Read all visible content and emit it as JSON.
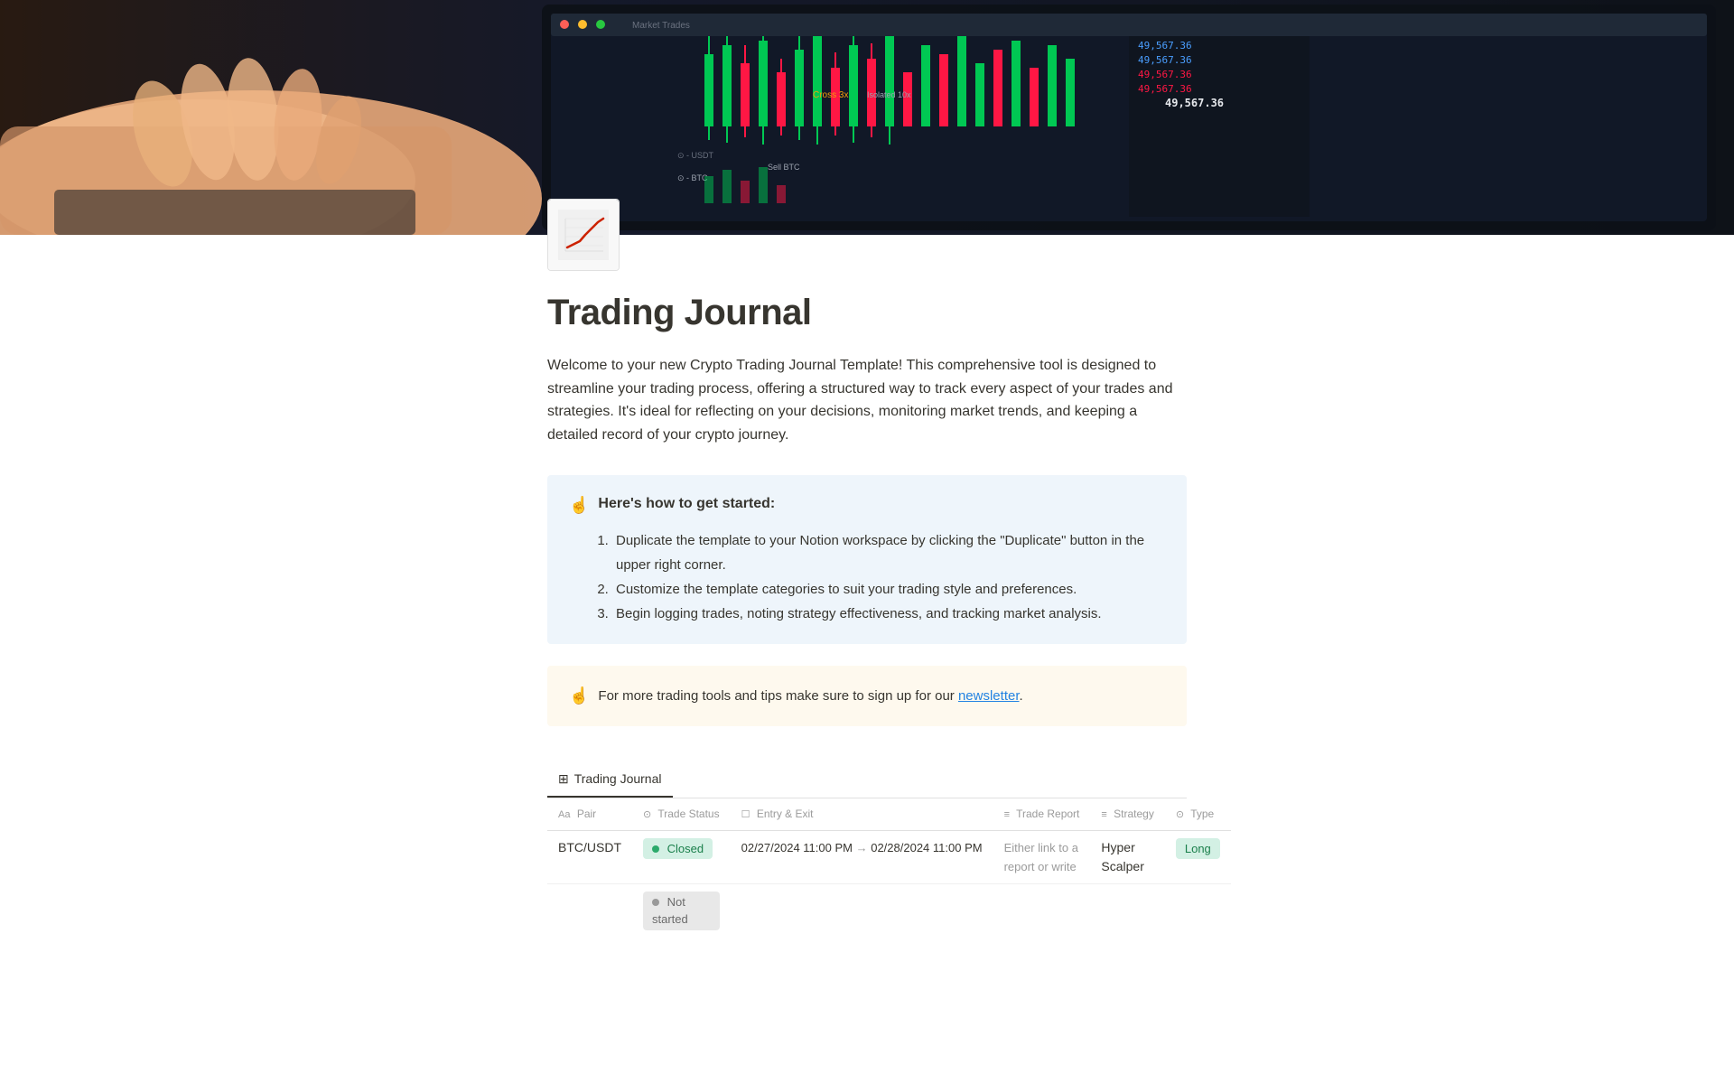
{
  "cover": {
    "alt": "Trading screen with candlestick charts"
  },
  "page": {
    "icon_alt": "Chart with upward trend icon",
    "title": "Trading Journal",
    "description": "Welcome to your new Crypto Trading Journal Template! This comprehensive tool is designed to streamline your trading process, offering a structured way to track every aspect of your trades and strategies. It's ideal for reflecting on your decisions, monitoring market trends, and keeping a detailed record of your crypto journey."
  },
  "getting_started": {
    "emoji": "☝️",
    "title": "Here's how to get started:",
    "steps": [
      "Duplicate the template to your Notion workspace by clicking the \"Duplicate\" button in the upper right corner.",
      "Customize the template categories to suit your trading style and preferences.",
      "Begin logging trades, noting strategy effectiveness, and tracking market analysis."
    ]
  },
  "newsletter_box": {
    "emoji": "☝️",
    "text_before": "For more trading tools and tips make sure to sign up for our",
    "link_text": "newsletter",
    "text_after": "."
  },
  "table": {
    "tab_label": "Trading Journal",
    "tab_icon": "⊞",
    "columns": [
      {
        "icon": "Aa",
        "label": "Pair"
      },
      {
        "icon": "⊙",
        "label": "Trade Status"
      },
      {
        "icon": "☐",
        "label": "Entry & Exit"
      },
      {
        "icon": "≡",
        "label": "Trade Report"
      },
      {
        "icon": "≡",
        "label": "Strategy"
      },
      {
        "icon": "⊙",
        "label": "Type"
      }
    ],
    "rows": [
      {
        "pair": "BTC/USDT",
        "status": "Closed",
        "status_type": "green",
        "entry": "02/27/2024 11:00 PM",
        "exit": "02/28/2024 11:00 PM",
        "report": "Either link to a report or write",
        "strategy": "Hyper Scalper",
        "type": "Long",
        "type_color": "green"
      },
      {
        "pair": "",
        "status": "Not started",
        "status_type": "gray",
        "entry": "",
        "exit": "",
        "report": "",
        "strategy": "",
        "type": "",
        "type_color": ""
      }
    ]
  },
  "colors": {
    "accent_blue": "#2383e2",
    "green_badge": "#2baa6b",
    "page_bg": "#ffffff"
  }
}
